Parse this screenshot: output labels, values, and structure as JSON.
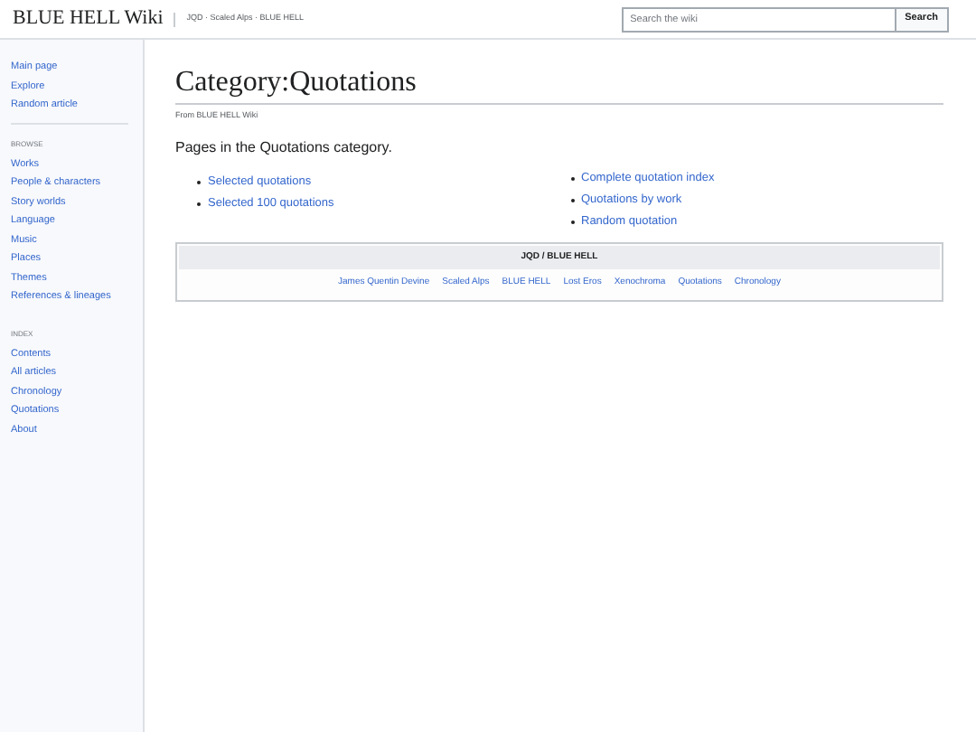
{
  "header": {
    "logo": "BLUE HELL Wiki",
    "tagline": "JQD · Scaled Alps · BLUE HELL",
    "search": {
      "placeholder": "Search the wiki",
      "button": "Search"
    }
  },
  "sidebar": {
    "top_items": [
      "Main page",
      "Explore",
      "Random article"
    ],
    "sections": [
      {
        "heading": "BROWSE",
        "items": [
          "Works",
          "People & characters",
          "Story worlds",
          "Language",
          "Music",
          "Places",
          "Themes",
          "References & lineages"
        ]
      },
      {
        "heading": "INDEX",
        "items": [
          "Contents",
          "All articles",
          "Chronology",
          "Quotations",
          "About"
        ]
      }
    ]
  },
  "page": {
    "title": "Category:Quotations",
    "subtitle": "From BLUE HELL Wiki",
    "intro": "Pages in the Quotations category.",
    "columns": [
      [
        "Selected quotations",
        "Selected 100 quotations"
      ],
      [
        "Complete quotation index",
        "Quotations by work",
        "Random quotation"
      ]
    ],
    "navbox": {
      "title": "JQD / BLUE HELL",
      "links": [
        "James Quentin Devine",
        "Scaled Alps",
        "BLUE HELL",
        "Lost Eros",
        "Xenochroma",
        "Quotations",
        "Chronology"
      ]
    }
  }
}
